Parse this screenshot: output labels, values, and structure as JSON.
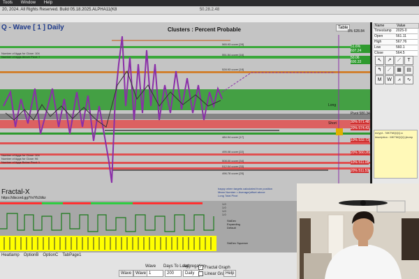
{
  "menu": {
    "items": [
      "Tools",
      "Window",
      "Help"
    ]
  },
  "titlebar": {
    "left": "20, 2024. All Rights Reserved. Build 05.18.2025.ALPHA11(K8",
    "center": "50.28.2.48"
  },
  "chart": {
    "title": "Q - Wave [ 1 ] Daily",
    "subtitle": "Clusters : Percent Probable",
    "watermark": "Fractal-X",
    "discord": "https://discord.gg/Yn/Yb2dkz",
    "table_btn": "Table",
    "legend_lines": [
      "Number of Aggs for Close: 104",
      "Number of Aggs Above Pivot: 7",
      "Number of Aggs for Close: 104",
      "Number of Aggs for Close: 96",
      "Number of Aggs Below Pivot: 1"
    ],
    "level_labels": [
      "565.93 cover [28]",
      "551.54 cover [16]",
      "528.93 cover [18]",
      "484.94 cover [17]",
      "495.08 cover [22]",
      "508.00 cover [34]",
      "512.04 cover [33]",
      "496.78 cover [25]"
    ],
    "right_axis": [
      "5% 628.84",
      "51.6% 607.24",
      "50.06 600.33",
      "Pivot 580.34",
      "30% 571.48",
      "20% 574.43",
      "10% 532.73",
      "10% 527.33",
      "20% 560.26",
      "10% 511.08",
      "0% 516.0",
      "20% 511.53",
      "Long",
      "Short"
    ],
    "bottom_notes": [
      "happy when targets calculated from position",
      "Mean Number = Average(offset above",
      "Long Total Pivot"
    ]
  },
  "lower_panel": {
    "labels": [
      "StdDev",
      "Expanding",
      "Default",
      "StdDev Squeeze",
      "1.0",
      "1.0",
      "1.0",
      "1.0"
    ]
  },
  "right_panel": {
    "table_headers": [
      "Name",
      "Value"
    ],
    "table_rows": [
      {
        "k": "Timestamp",
        "v": "2025-0"
      },
      {
        "k": "Open",
        "v": "561.11"
      },
      {
        "k": "High",
        "v": "567.76"
      },
      {
        "k": "Low",
        "v": "560.1"
      },
      {
        "k": "Close",
        "v": "564.5"
      }
    ],
    "tools": [
      "↖",
      "↗",
      "⟋",
      "T",
      "↰",
      "⟋",
      "▦",
      "▤",
      "M",
      "W",
      "⩘",
      "∿"
    ],
    "notes": [
      "ecrypt - 'MKTMQQQ.a",
      "lescription : MKTMQQQ.jlevep"
    ]
  },
  "bottom": {
    "tabs": [
      "Heatlamp",
      "OptionB",
      "OptionC",
      "TabPage1"
    ],
    "wave_label": "Wave",
    "wave_value": "1",
    "days_label": "Days To Load",
    "days_value": "200",
    "agg_label": "Aggregation",
    "agg_value": "Daily",
    "buttons": [
      "Wave",
      "Wave",
      "Help"
    ],
    "check_fractal": "Fractal Graph",
    "check_linear": "Linear Graph"
  },
  "colors": {
    "green_band": "#2e9a2e",
    "red_band": "#e05050",
    "purple": "#8a2fa8",
    "yellow_strip": "#ffff00"
  }
}
